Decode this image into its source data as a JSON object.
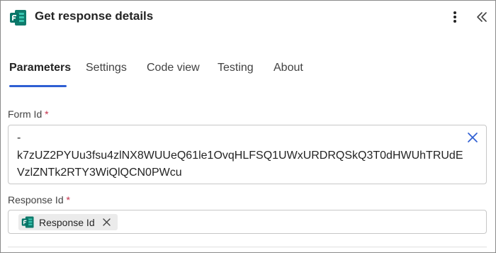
{
  "header": {
    "title": "Get response details",
    "app_icon": "microsoft-forms-icon",
    "more_icon": "more-vertical-icon",
    "collapse_icon": "double-chevron-left-icon"
  },
  "tabs": [
    {
      "label": "Parameters",
      "active": true
    },
    {
      "label": "Settings",
      "active": false
    },
    {
      "label": "Code view",
      "active": false
    },
    {
      "label": "Testing",
      "active": false
    },
    {
      "label": "About",
      "active": false
    }
  ],
  "fields": {
    "form_id": {
      "label": "Form Id",
      "required_mark": "*",
      "value": "-\nk7zUZ2PYUu3fsu4zlNX8WUUeQ61le1OvqHLFSQ1UWxURDRQSkQ3T0dHWUhTRUdEVzlZNTk2RTY3WiQlQCN0PWcu",
      "clear_icon": "close-icon"
    },
    "response_id": {
      "label": "Response Id",
      "required_mark": "*",
      "token": {
        "label": "Response Id",
        "icon": "microsoft-forms-icon",
        "remove_icon": "close-icon"
      }
    }
  },
  "colors": {
    "accent": "#2f5fd3",
    "required": "#c4314b",
    "forms_green": "#077568"
  }
}
